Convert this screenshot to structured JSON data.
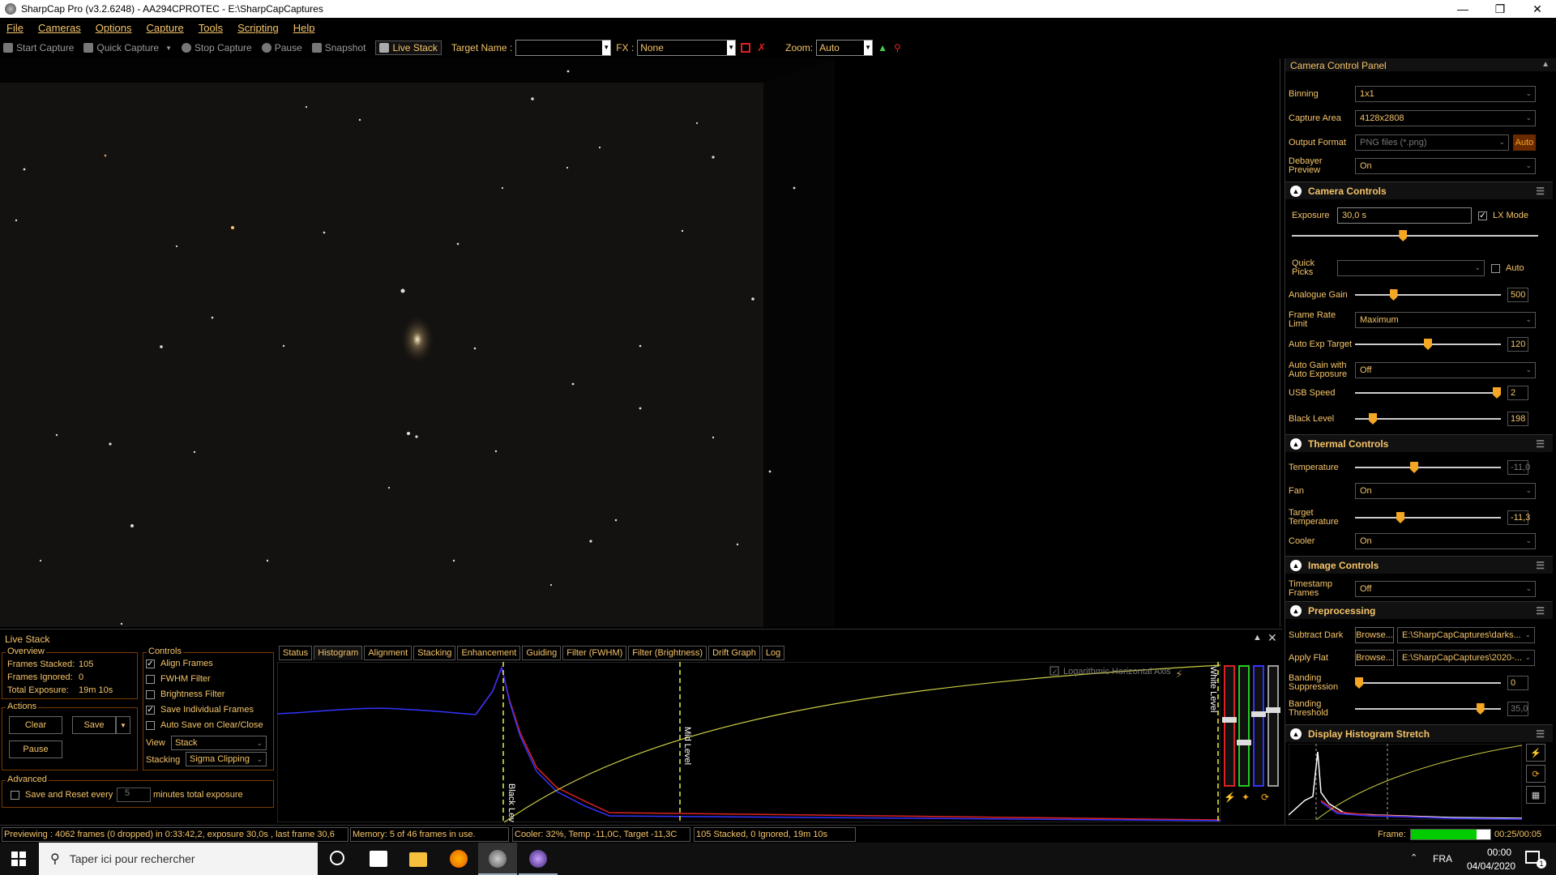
{
  "window": {
    "title": "SharpCap Pro (v3.2.6248) - AA294CPROTEC - E:\\SharpCapCaptures"
  },
  "menu": [
    "File",
    "Cameras",
    "Options",
    "Capture",
    "Tools",
    "Scripting",
    "Help"
  ],
  "toolbar": {
    "start_capture": "Start Capture",
    "quick_capture": "Quick Capture",
    "stop_capture": "Stop Capture",
    "pause": "Pause",
    "snapshot": "Snapshot",
    "live_stack": "Live Stack",
    "target_name_label": "Target Name :",
    "target_name_value": "",
    "fx_label": "FX :",
    "fx_value": "None",
    "zoom_label": "Zoom:",
    "zoom_value": "Auto"
  },
  "camera_panel": {
    "title": "Camera Control Panel",
    "binning": {
      "label": "Binning",
      "value": "1x1"
    },
    "capture_area": {
      "label": "Capture Area",
      "value": "4128x2808"
    },
    "output_format": {
      "label": "Output Format",
      "value": "PNG files (*.png)",
      "auto": "Auto"
    },
    "debayer_preview": {
      "label": "Debayer Preview",
      "value": "On"
    },
    "camera_controls": {
      "title": "Camera Controls",
      "exposure_label": "Exposure",
      "exposure_value": "30,0 s",
      "lx_mode_label": "LX Mode",
      "lx_mode_checked": true,
      "exposure_level": 0.45,
      "quick_picks_label": "Quick Picks",
      "quick_picks_auto": "Auto",
      "analogue_gain": {
        "label": "Analogue Gain",
        "value": "500",
        "level": 0.25
      },
      "frame_rate_limit": {
        "label": "Frame Rate Limit",
        "value": "Maximum"
      },
      "auto_exp_target": {
        "label": "Auto Exp Target",
        "value": "120",
        "level": 0.5
      },
      "auto_gain": {
        "label": "Auto Gain with Auto Exposure",
        "value": "Off"
      },
      "usb_speed": {
        "label": "USB Speed",
        "value": "2",
        "level": 1.0
      },
      "black_level": {
        "label": "Black Level",
        "value": "198",
        "level": 0.1
      }
    },
    "thermal_controls": {
      "title": "Thermal Controls",
      "temperature": {
        "label": "Temperature",
        "value": "-11,0",
        "level": 0.4
      },
      "fan": {
        "label": "Fan",
        "value": "On"
      },
      "target_temperature": {
        "label": "Target Temperature",
        "value": "-11,3",
        "level": 0.3
      },
      "cooler": {
        "label": "Cooler",
        "value": "On"
      }
    },
    "image_controls": {
      "title": "Image Controls",
      "timestamp_frames": {
        "label": "Timestamp Frames",
        "value": "Off"
      }
    },
    "preprocessing": {
      "title": "Preprocessing",
      "subtract_dark": {
        "label": "Subtract Dark",
        "browse": "Browse...",
        "value": "E:\\SharpCapCaptures\\darks..."
      },
      "apply_flat": {
        "label": "Apply Flat",
        "browse": "Browse...",
        "value": "E:\\SharpCapCaptures\\2020-..."
      },
      "banding_suppression": {
        "label": "Banding Suppression",
        "value": "0",
        "level": 0.0
      },
      "banding_threshold": {
        "label": "Banding Threshold",
        "value": "35,0",
        "level": 0.88
      }
    },
    "display_histogram": {
      "title": "Display Histogram Stretch"
    }
  },
  "live_stack": {
    "title": "Live Stack",
    "overview": {
      "title": "Overview",
      "frames_stacked_label": "Frames Stacked:",
      "frames_stacked": "105",
      "frames_ignored_label": "Frames Ignored:",
      "frames_ignored": "0",
      "total_exposure_label": "Total Exposure:",
      "total_exposure": "19m 10s"
    },
    "actions": {
      "title": "Actions",
      "clear": "Clear",
      "save": "Save",
      "pause": "Pause"
    },
    "advanced": {
      "title": "Advanced",
      "save_reset_label": "Save and Reset every",
      "save_reset_value": "5",
      "minutes_label": "minutes total exposure"
    },
    "controls": {
      "title": "Controls",
      "align_frames": "Align Frames",
      "fwhm_filter": "FWHM Filter",
      "brightness_filter": "Brightness Filter",
      "save_individual": "Save Individual Frames",
      "auto_save": "Auto Save on Clear/Close",
      "view_label": "View",
      "view_value": "Stack",
      "stacking_label": "Stacking",
      "stacking_value": "Sigma Clipping"
    },
    "tabs": [
      "Status",
      "Histogram",
      "Alignment",
      "Stacking",
      "Enhancement",
      "Guiding",
      "Filter (FWHM)",
      "Filter (Brightness)",
      "Drift Graph",
      "Log"
    ],
    "histogram": {
      "log_axis_label": "Logarithmic Horizontal Axis",
      "black_level_label": "Black Level",
      "mid_level_label": "Mid Level",
      "white_level_label": "White Level"
    }
  },
  "status": {
    "preview": "Previewing : 4062 frames (0 dropped) in 0:33:42,2, exposure 30,0s , last frame 30,6",
    "memory": "Memory: 5 of 46 frames in use.",
    "cooler": "Cooler: 32%, Temp -11,0C, Target -11,3C",
    "stacked": "105 Stacked, 0 Ignored, 19m 10s",
    "frame_label": "Frame:",
    "frame_time": "00:25/00:05",
    "frame_progress": 0.83
  },
  "taskbar": {
    "search_placeholder": "Taper ici pour rechercher",
    "lang": "FRA",
    "time": "00:00",
    "date": "04/04/2020",
    "notif_count": "1"
  }
}
